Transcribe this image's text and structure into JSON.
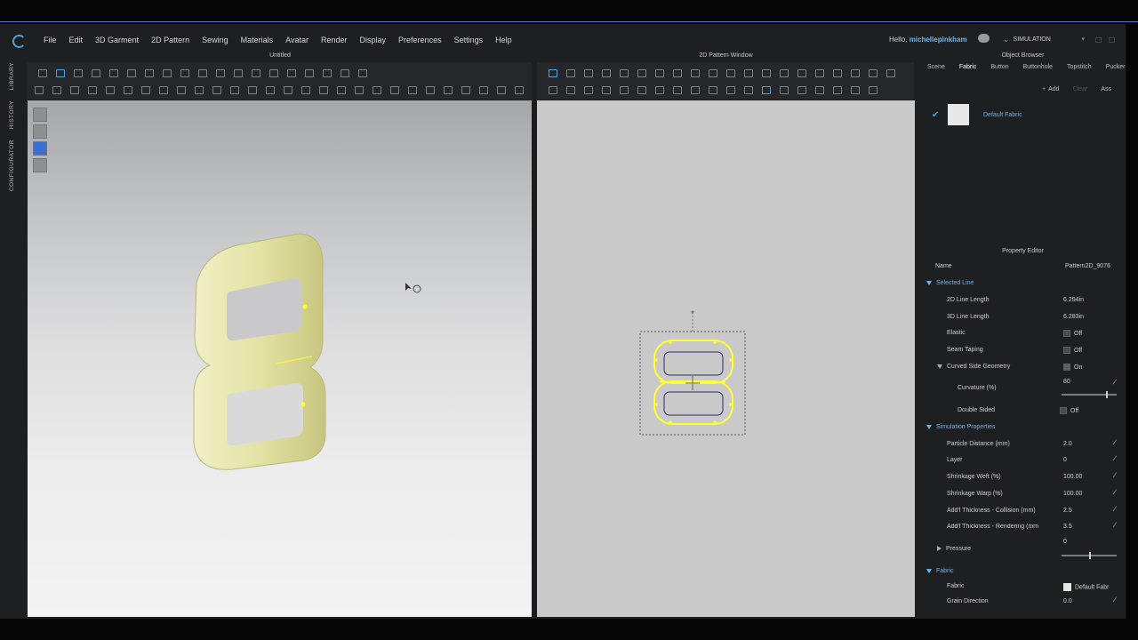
{
  "app": {
    "logo_icon": "clo-logo-icon",
    "accent_color": "#4aa3e0"
  },
  "menu": [
    "File",
    "Edit",
    "3D Garment",
    "2D Pattern",
    "Sewing",
    "Materials",
    "Avatar",
    "Render",
    "Display",
    "Preferences",
    "Settings",
    "Help"
  ],
  "user": {
    "greeting": "Hello,",
    "name": "michellepinkham"
  },
  "mode": {
    "label": "SIMULATION"
  },
  "side_tabs": [
    "LIBRARY",
    "HISTORY",
    "CONFIGURATOR"
  ],
  "panel3d": {
    "title": "Untitled",
    "object_color": "#e6e6a6"
  },
  "panel2d": {
    "title": "2D Pattern Window",
    "highlight_color": "#ffff33"
  },
  "object_browser": {
    "title": "Object Browser",
    "tabs": [
      "Scene",
      "Fabric",
      "Button",
      "Buttonhole",
      "Topstitch",
      "Puckering"
    ],
    "active_tab": "Fabric",
    "add_label": "Add",
    "clear_label": "Clear",
    "assign_label": "Ass",
    "item_name": "Default Fabric"
  },
  "property_editor": {
    "title": "Property Editor",
    "name_label": "Name",
    "name_value": "Pattern2D_9076",
    "selected_line": {
      "label": "Selected Line",
      "len2d_label": "2D Line Length",
      "len2d": "6.294in",
      "len3d_label": "3D Line Length",
      "len3d": "6.283in",
      "elastic_label": "Elastic",
      "elastic": "Off",
      "seam_label": "Seam Taping",
      "seam": "Off",
      "curved_label": "Curved Side Geometry",
      "curved": "On",
      "curvature_label": "Curvature (%)",
      "curvature": "80",
      "double_label": "Double Sided",
      "double": "Off"
    },
    "simulation": {
      "label": "Simulation Properties",
      "particle_label": "Particle Distance (mm)",
      "particle": "2.0",
      "layer_label": "Layer",
      "layer": "0",
      "weft_label": "Shrinkage Weft (%)",
      "weft": "100.00",
      "warp_label": "Shrinkage Warp (%)",
      "warp": "100.00",
      "collision_label": "Add'l Thickness - Collision (mm)",
      "collision": "2.5",
      "render_label": "Add'l Thickness - Rendering (mm",
      "render": "3.5",
      "pressure_label": "Pressure",
      "pressure": "0"
    },
    "fabric": {
      "label": "Fabric",
      "fabric_label": "Fabric",
      "fabric_value": "Default Fabr",
      "grain_label": "Grain Direction",
      "grain": "0.0"
    }
  }
}
